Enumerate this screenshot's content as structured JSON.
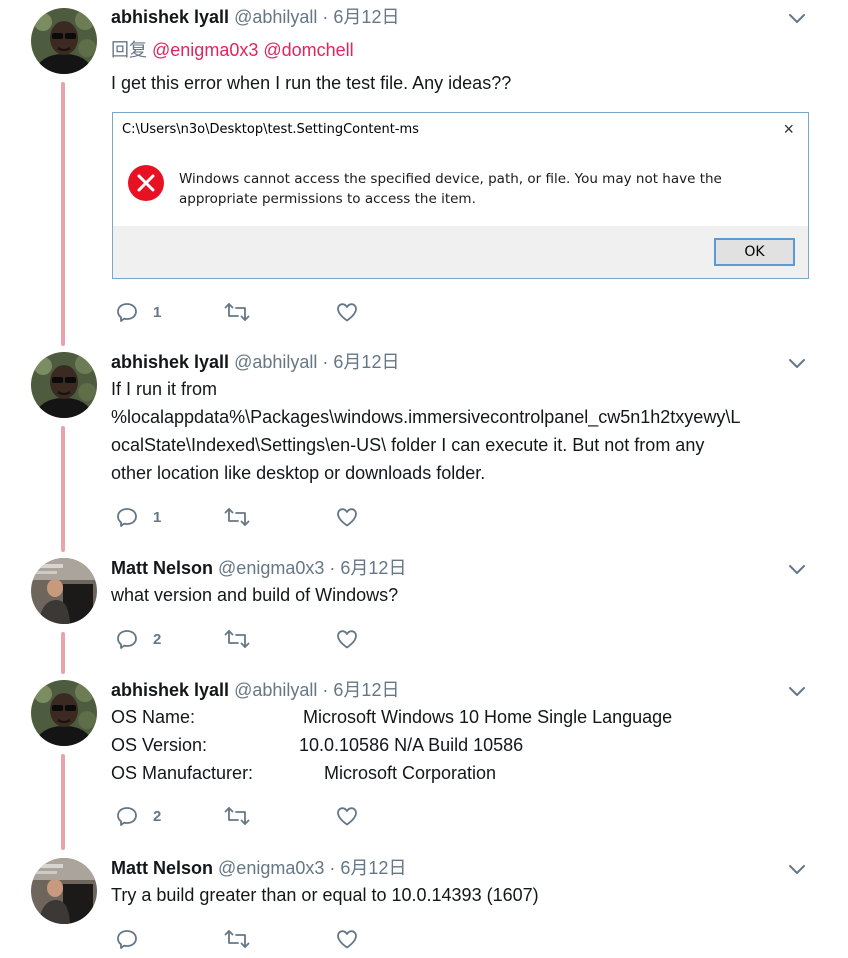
{
  "tweets": [
    {
      "name": "abhishek lyall",
      "handle": "@abhilyall",
      "sep": "·",
      "date": "6月12日",
      "reply_prefix": "回复",
      "mentions": [
        "@enigma0x3",
        "@domchell"
      ],
      "text": "I get this error when I run the test file. Any ideas??",
      "reply_count": "1",
      "dialog": {
        "title": "C:\\Users\\n3o\\Desktop\\test.SettingContent-ms",
        "close": "×",
        "message": "Windows cannot access the specified device, path, or file. You may not have the appropriate permissions to access the item.",
        "ok": "OK"
      }
    },
    {
      "name": "abhishek lyall",
      "handle": "@abhilyall",
      "sep": "·",
      "date": "6月12日",
      "lines": [
        "If I run it from",
        "%localappdata%\\Packages\\windows.immersivecontrolpanel_cw5n1h2txyewy\\L",
        "ocalState\\Indexed\\Settings\\en-US\\ folder I can execute it. But not from any",
        "other location like desktop or downloads folder."
      ],
      "reply_count": "1"
    },
    {
      "name": "Matt Nelson",
      "handle": "@enigma0x3",
      "sep": "·",
      "date": "6月12日",
      "text": "what version and build of Windows?",
      "reply_count": "2"
    },
    {
      "name": "abhishek lyall",
      "handle": "@abhilyall",
      "sep": "·",
      "date": "6月12日",
      "os_rows": [
        {
          "label": "OS Name:",
          "value": "Microsoft Windows 10 Home Single Language"
        },
        {
          "label": "OS Version:",
          "value": "10.0.10586 N/A Build 10586"
        },
        {
          "label": "OS Manufacturer:",
          "value": "Microsoft Corporation"
        }
      ],
      "reply_count": "2"
    },
    {
      "name": "Matt Nelson",
      "handle": "@enigma0x3",
      "sep": "·",
      "date": "6月12日",
      "text": "Try a build greater than or equal to 10.0.14393 (1607)",
      "reply_count": ""
    }
  ],
  "colors": {
    "thread_line": "#e8a3ad",
    "mention": "#e0245e",
    "muted": "#657786",
    "error_red": "#e81123"
  },
  "icons": [
    "reply-icon",
    "retweet-icon",
    "like-icon",
    "chevron-down-icon",
    "error-icon"
  ]
}
